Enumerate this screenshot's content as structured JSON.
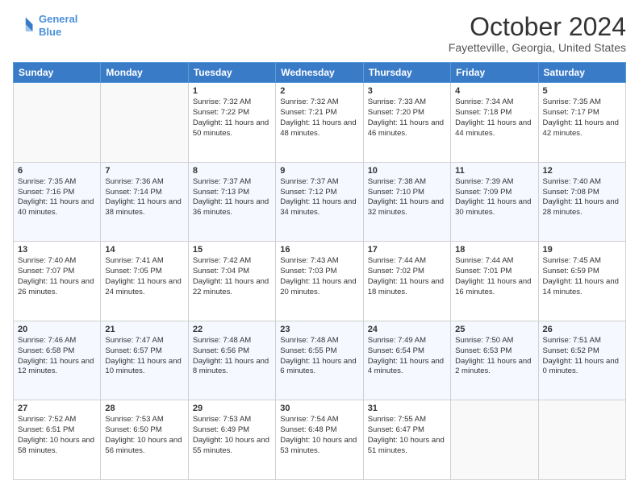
{
  "header": {
    "logo_line1": "General",
    "logo_line2": "Blue",
    "month": "October 2024",
    "location": "Fayetteville, Georgia, United States"
  },
  "weekdays": [
    "Sunday",
    "Monday",
    "Tuesday",
    "Wednesday",
    "Thursday",
    "Friday",
    "Saturday"
  ],
  "weeks": [
    [
      {
        "day": "",
        "sunrise": "",
        "sunset": "",
        "daylight": ""
      },
      {
        "day": "",
        "sunrise": "",
        "sunset": "",
        "daylight": ""
      },
      {
        "day": "1",
        "sunrise": "Sunrise: 7:32 AM",
        "sunset": "Sunset: 7:22 PM",
        "daylight": "Daylight: 11 hours and 50 minutes."
      },
      {
        "day": "2",
        "sunrise": "Sunrise: 7:32 AM",
        "sunset": "Sunset: 7:21 PM",
        "daylight": "Daylight: 11 hours and 48 minutes."
      },
      {
        "day": "3",
        "sunrise": "Sunrise: 7:33 AM",
        "sunset": "Sunset: 7:20 PM",
        "daylight": "Daylight: 11 hours and 46 minutes."
      },
      {
        "day": "4",
        "sunrise": "Sunrise: 7:34 AM",
        "sunset": "Sunset: 7:18 PM",
        "daylight": "Daylight: 11 hours and 44 minutes."
      },
      {
        "day": "5",
        "sunrise": "Sunrise: 7:35 AM",
        "sunset": "Sunset: 7:17 PM",
        "daylight": "Daylight: 11 hours and 42 minutes."
      }
    ],
    [
      {
        "day": "6",
        "sunrise": "Sunrise: 7:35 AM",
        "sunset": "Sunset: 7:16 PM",
        "daylight": "Daylight: 11 hours and 40 minutes."
      },
      {
        "day": "7",
        "sunrise": "Sunrise: 7:36 AM",
        "sunset": "Sunset: 7:14 PM",
        "daylight": "Daylight: 11 hours and 38 minutes."
      },
      {
        "day": "8",
        "sunrise": "Sunrise: 7:37 AM",
        "sunset": "Sunset: 7:13 PM",
        "daylight": "Daylight: 11 hours and 36 minutes."
      },
      {
        "day": "9",
        "sunrise": "Sunrise: 7:37 AM",
        "sunset": "Sunset: 7:12 PM",
        "daylight": "Daylight: 11 hours and 34 minutes."
      },
      {
        "day": "10",
        "sunrise": "Sunrise: 7:38 AM",
        "sunset": "Sunset: 7:10 PM",
        "daylight": "Daylight: 11 hours and 32 minutes."
      },
      {
        "day": "11",
        "sunrise": "Sunrise: 7:39 AM",
        "sunset": "Sunset: 7:09 PM",
        "daylight": "Daylight: 11 hours and 30 minutes."
      },
      {
        "day": "12",
        "sunrise": "Sunrise: 7:40 AM",
        "sunset": "Sunset: 7:08 PM",
        "daylight": "Daylight: 11 hours and 28 minutes."
      }
    ],
    [
      {
        "day": "13",
        "sunrise": "Sunrise: 7:40 AM",
        "sunset": "Sunset: 7:07 PM",
        "daylight": "Daylight: 11 hours and 26 minutes."
      },
      {
        "day": "14",
        "sunrise": "Sunrise: 7:41 AM",
        "sunset": "Sunset: 7:05 PM",
        "daylight": "Daylight: 11 hours and 24 minutes."
      },
      {
        "day": "15",
        "sunrise": "Sunrise: 7:42 AM",
        "sunset": "Sunset: 7:04 PM",
        "daylight": "Daylight: 11 hours and 22 minutes."
      },
      {
        "day": "16",
        "sunrise": "Sunrise: 7:43 AM",
        "sunset": "Sunset: 7:03 PM",
        "daylight": "Daylight: 11 hours and 20 minutes."
      },
      {
        "day": "17",
        "sunrise": "Sunrise: 7:44 AM",
        "sunset": "Sunset: 7:02 PM",
        "daylight": "Daylight: 11 hours and 18 minutes."
      },
      {
        "day": "18",
        "sunrise": "Sunrise: 7:44 AM",
        "sunset": "Sunset: 7:01 PM",
        "daylight": "Daylight: 11 hours and 16 minutes."
      },
      {
        "day": "19",
        "sunrise": "Sunrise: 7:45 AM",
        "sunset": "Sunset: 6:59 PM",
        "daylight": "Daylight: 11 hours and 14 minutes."
      }
    ],
    [
      {
        "day": "20",
        "sunrise": "Sunrise: 7:46 AM",
        "sunset": "Sunset: 6:58 PM",
        "daylight": "Daylight: 11 hours and 12 minutes."
      },
      {
        "day": "21",
        "sunrise": "Sunrise: 7:47 AM",
        "sunset": "Sunset: 6:57 PM",
        "daylight": "Daylight: 11 hours and 10 minutes."
      },
      {
        "day": "22",
        "sunrise": "Sunrise: 7:48 AM",
        "sunset": "Sunset: 6:56 PM",
        "daylight": "Daylight: 11 hours and 8 minutes."
      },
      {
        "day": "23",
        "sunrise": "Sunrise: 7:48 AM",
        "sunset": "Sunset: 6:55 PM",
        "daylight": "Daylight: 11 hours and 6 minutes."
      },
      {
        "day": "24",
        "sunrise": "Sunrise: 7:49 AM",
        "sunset": "Sunset: 6:54 PM",
        "daylight": "Daylight: 11 hours and 4 minutes."
      },
      {
        "day": "25",
        "sunrise": "Sunrise: 7:50 AM",
        "sunset": "Sunset: 6:53 PM",
        "daylight": "Daylight: 11 hours and 2 minutes."
      },
      {
        "day": "26",
        "sunrise": "Sunrise: 7:51 AM",
        "sunset": "Sunset: 6:52 PM",
        "daylight": "Daylight: 11 hours and 0 minutes."
      }
    ],
    [
      {
        "day": "27",
        "sunrise": "Sunrise: 7:52 AM",
        "sunset": "Sunset: 6:51 PM",
        "daylight": "Daylight: 10 hours and 58 minutes."
      },
      {
        "day": "28",
        "sunrise": "Sunrise: 7:53 AM",
        "sunset": "Sunset: 6:50 PM",
        "daylight": "Daylight: 10 hours and 56 minutes."
      },
      {
        "day": "29",
        "sunrise": "Sunrise: 7:53 AM",
        "sunset": "Sunset: 6:49 PM",
        "daylight": "Daylight: 10 hours and 55 minutes."
      },
      {
        "day": "30",
        "sunrise": "Sunrise: 7:54 AM",
        "sunset": "Sunset: 6:48 PM",
        "daylight": "Daylight: 10 hours and 53 minutes."
      },
      {
        "day": "31",
        "sunrise": "Sunrise: 7:55 AM",
        "sunset": "Sunset: 6:47 PM",
        "daylight": "Daylight: 10 hours and 51 minutes."
      },
      {
        "day": "",
        "sunrise": "",
        "sunset": "",
        "daylight": ""
      },
      {
        "day": "",
        "sunrise": "",
        "sunset": "",
        "daylight": ""
      }
    ]
  ]
}
